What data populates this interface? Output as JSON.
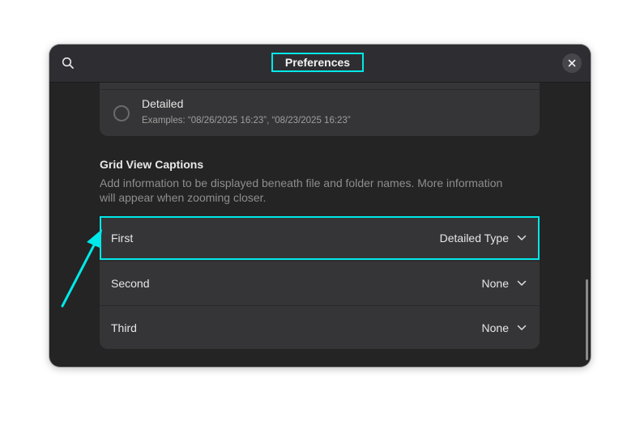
{
  "header": {
    "title": "Preferences",
    "search_icon": "search-icon",
    "close_icon": "close-icon"
  },
  "date_format": {
    "option_label": "Detailed",
    "option_example": "Examples: “08/26/2025 16:23”, “08/23/2025 16:23”",
    "selected": false
  },
  "grid_captions": {
    "title": "Grid View Captions",
    "description": "Add information to be displayed beneath file and folder names. More information will appear when zooming closer.",
    "rows": [
      {
        "label": "First",
        "value": "Detailed Type"
      },
      {
        "label": "Second",
        "value": "None"
      },
      {
        "label": "Third",
        "value": "None"
      }
    ]
  },
  "annotation": {
    "highlight_color": "#00e8e8",
    "arrow_icon": "arrow-annotation"
  }
}
